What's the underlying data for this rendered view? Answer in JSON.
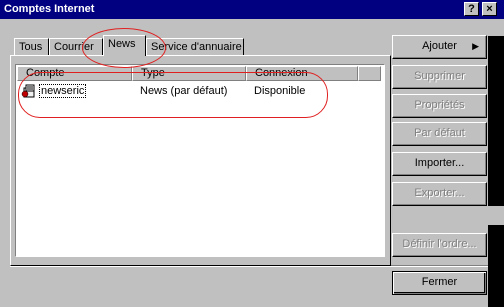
{
  "window": {
    "title": "Comptes Internet",
    "help_label": "?",
    "close_label": "×"
  },
  "tabs": [
    {
      "label": "Tous"
    },
    {
      "label": "Courrier"
    },
    {
      "label": "News",
      "active": true
    },
    {
      "label": "Service d'annuaire"
    }
  ],
  "table": {
    "columns": [
      "Compte",
      "Type",
      "Connexion"
    ],
    "rows": [
      {
        "compte": "newseric",
        "type": "News (par défaut)",
        "connexion": "Disponible"
      }
    ]
  },
  "buttons": {
    "ajouter": "Ajouter",
    "supprimer": "Supprimer",
    "proprietes": "Propriétés",
    "par_defaut": "Par défaut",
    "importer": "Importer...",
    "exporter": "Exporter...",
    "definir_ordre": "Définir l'ordre...",
    "fermer": "Fermer"
  },
  "colors": {
    "titlebar": "#000080",
    "annotation": "#e02020"
  }
}
